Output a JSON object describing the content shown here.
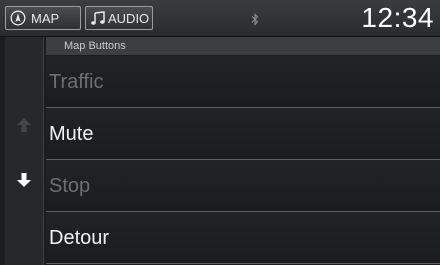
{
  "status_bar": {
    "map_tab": {
      "label": "MAP",
      "icon": "compass-icon"
    },
    "audio_tab": {
      "label": "AUDIO",
      "icon": "music-note-icon"
    },
    "bluetooth_icon": "bluetooth-icon",
    "clock": "12:34"
  },
  "header": {
    "title": "Map Buttons"
  },
  "menu": {
    "items": [
      {
        "label": "Traffic",
        "enabled": false
      },
      {
        "label": "Mute",
        "enabled": true
      },
      {
        "label": "Stop",
        "enabled": false
      },
      {
        "label": "Detour",
        "enabled": true
      }
    ]
  },
  "scroll": {
    "up_icon": "arrow-up-icon",
    "down_icon": "arrow-down-icon",
    "up_enabled": false,
    "down_enabled": true
  },
  "colors": {
    "background": "#1b1c1e",
    "text_enabled": "#f2f2f2",
    "text_disabled": "#6c6e72",
    "divider": "#5d6064"
  }
}
